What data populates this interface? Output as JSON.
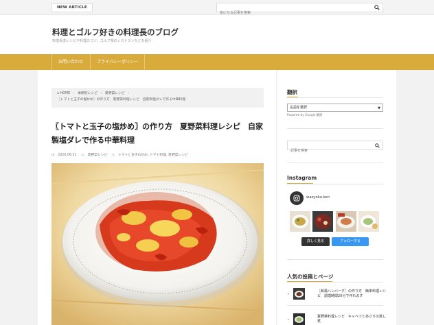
{
  "topbar": {
    "new_article_label": "NEW ARTICLE",
    "search_placeholder": "気になる記事を検索"
  },
  "header": {
    "site_title": "料理とゴルフ好きの料理長のブログ",
    "site_description": "料理長流レシピや料理のコツ、ゴルフ場のレストランなどを紹介"
  },
  "nav": {
    "items": [
      "お問い合わせ",
      "プライバシーポリシー"
    ]
  },
  "breadcrumb": {
    "items": [
      "HOME",
      "季節別レシピ",
      "夏野菜レシピ"
    ],
    "current": "〖トマトと玉子の塩炒め〗の作り方　夏野菜料理レシピ　自家製塩ダレで作る中華料理"
  },
  "post": {
    "title": "〖トマトと玉子の塩炒め〗の作り方　夏野菜料理レシピ　自家製塩ダレで作る中華料理",
    "date": "2020.06.21",
    "category": "夏野菜レシピ",
    "tags": "トマトと玉子の炒め, トマト料理, 夏野菜レシピ"
  },
  "sidebar": {
    "translate_title": "翻訳",
    "language_select": "言語を選択",
    "powered_by": "Powered by Google 翻訳",
    "search_placeholder": "記事を検索",
    "instagram_title": "Instagram",
    "instagram_user": "wasyoku.ken",
    "more_label": "詳しく見る",
    "follow_label": "フォローする",
    "popular_title": "人気の投稿とページ",
    "popular_items": [
      "〖和風ハンバーグ〗の作り方　簡単料理レシピ　調理時間20分で作れます",
      "夏野菜料理レシピ　キャベツとあさりの蒸し煮"
    ]
  },
  "colors": {
    "accent": "#d9ab3b",
    "follow_button": "#3897f0"
  }
}
